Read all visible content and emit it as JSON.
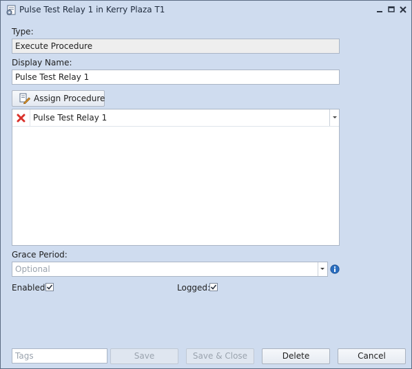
{
  "window": {
    "title": "Pulse Test Relay 1 in Kerry Plaza T1",
    "icon": "procedure-window-icon",
    "controls": [
      "minimize-icon",
      "maximize-icon",
      "close-icon"
    ]
  },
  "form": {
    "type_label": "Type:",
    "type_value": "Execute Procedure",
    "display_name_label": "Display Name:",
    "display_name_value": "Pulse Test Relay 1",
    "assign_label": "Assign Procedure",
    "procedures": [
      {
        "name": "Pulse Test Relay 1"
      }
    ],
    "grace_label": "Grace Period:",
    "grace_placeholder": "Optional",
    "enabled_label": "Enabled:",
    "enabled": true,
    "logged_label": "Logged:",
    "logged": true
  },
  "footer": {
    "tags_placeholder": "Tags",
    "save_label": "Save",
    "save_close_label": "Save & Close",
    "delete_label": "Delete",
    "cancel_label": "Cancel"
  },
  "colors": {
    "window_bg": "#cfdcef",
    "remove_red": "#d9312b",
    "info_blue": "#2a6ec0"
  }
}
